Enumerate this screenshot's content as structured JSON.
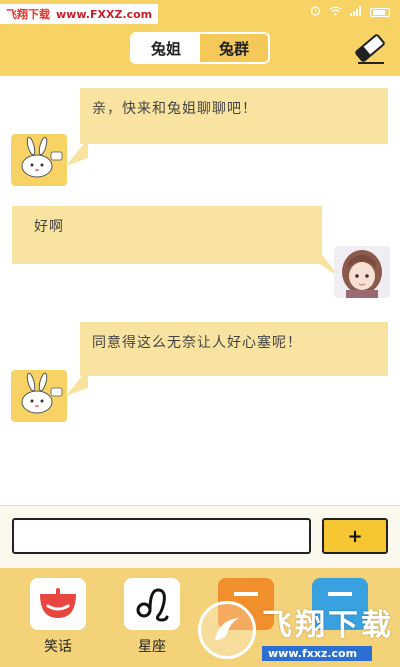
{
  "watermark_top": {
    "site_name": "飞翔下载",
    "url": "www.FXXZ.com"
  },
  "status_bar": {
    "icons": [
      "alarm-icon",
      "wifi-icon",
      "signal-icon",
      "battery-icon"
    ]
  },
  "header": {
    "tabs": [
      {
        "label": "兔姐",
        "active": true
      },
      {
        "label": "兔群",
        "active": false
      }
    ],
    "clear_icon": "eraser-icon"
  },
  "chat": {
    "messages": [
      {
        "sender": "bot",
        "text": "亲，快来和兔姐聊聊吧！"
      },
      {
        "sender": "user",
        "text": "好啊"
      },
      {
        "sender": "bot",
        "text": "同意得这么无奈让人好心塞呢！"
      }
    ]
  },
  "input": {
    "value": "",
    "placeholder": "",
    "send_label": "+"
  },
  "bottom_nav": {
    "items": [
      {
        "label": "笑话",
        "icon": "joke-icon"
      },
      {
        "label": "星座",
        "icon": "leo-zodiac-icon"
      },
      {
        "label": "",
        "icon": "orange-app-icon"
      },
      {
        "label": "",
        "icon": "blue-app-icon"
      }
    ]
  },
  "watermark_bottom": {
    "title": "飞翔下载",
    "url": "www.fxxz.com"
  },
  "colors": {
    "accent": "#f7d264",
    "bubble": "#f9e3a0",
    "send": "#f7c633"
  }
}
